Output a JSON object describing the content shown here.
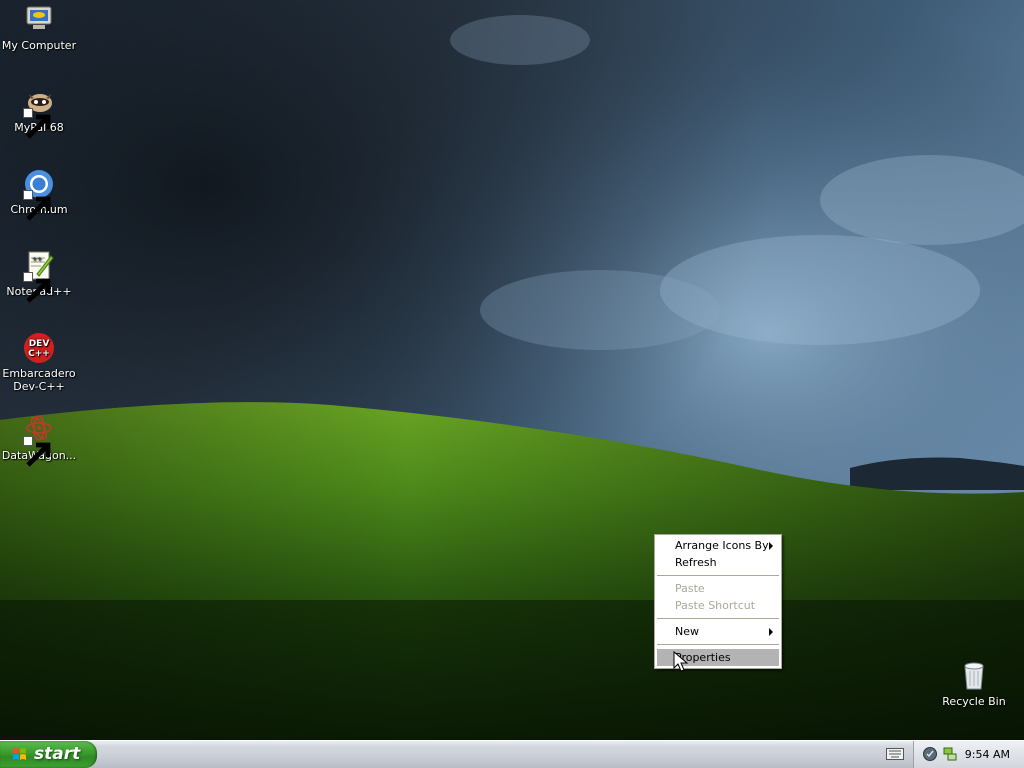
{
  "desktop_icons": [
    {
      "label": "My Computer",
      "icon": "my-computer-icon",
      "shortcut": false
    },
    {
      "label": "MyPal 68",
      "icon": "mypal-icon",
      "shortcut": true
    },
    {
      "label": "Chromium",
      "icon": "chromium-icon",
      "shortcut": true
    },
    {
      "label": "Notepad++",
      "icon": "notepadpp-icon",
      "shortcut": true
    },
    {
      "label": "Embarcadero Dev-C++",
      "icon": "devcpp-icon",
      "shortcut": true
    },
    {
      "label": "DataWagon...",
      "icon": "datawagon-icon",
      "shortcut": true
    }
  ],
  "recycle_bin": {
    "label": "Recycle Bin",
    "icon": "recycle-bin-icon"
  },
  "context_menu": {
    "items": [
      {
        "label": "Arrange Icons By",
        "submenu": true,
        "disabled": false
      },
      {
        "label": "Refresh",
        "submenu": false,
        "disabled": false
      },
      {
        "label": "Paste",
        "submenu": false,
        "disabled": true
      },
      {
        "label": "Paste Shortcut",
        "submenu": false,
        "disabled": true
      },
      {
        "label": "New",
        "submenu": true,
        "disabled": false
      },
      {
        "label": "Properties",
        "submenu": false,
        "disabled": false,
        "highlighted": true
      }
    ]
  },
  "taskbar": {
    "start_label": "start",
    "clock": "9:54 AM",
    "tray_icons": [
      "security-shield-icon",
      "network-icon"
    ],
    "language_icon": "keyboard-icon"
  },
  "colors": {
    "start_green": "#3c9a2f",
    "menu_highlight": "#b3b3b3",
    "disabled_text": "#aca899"
  }
}
